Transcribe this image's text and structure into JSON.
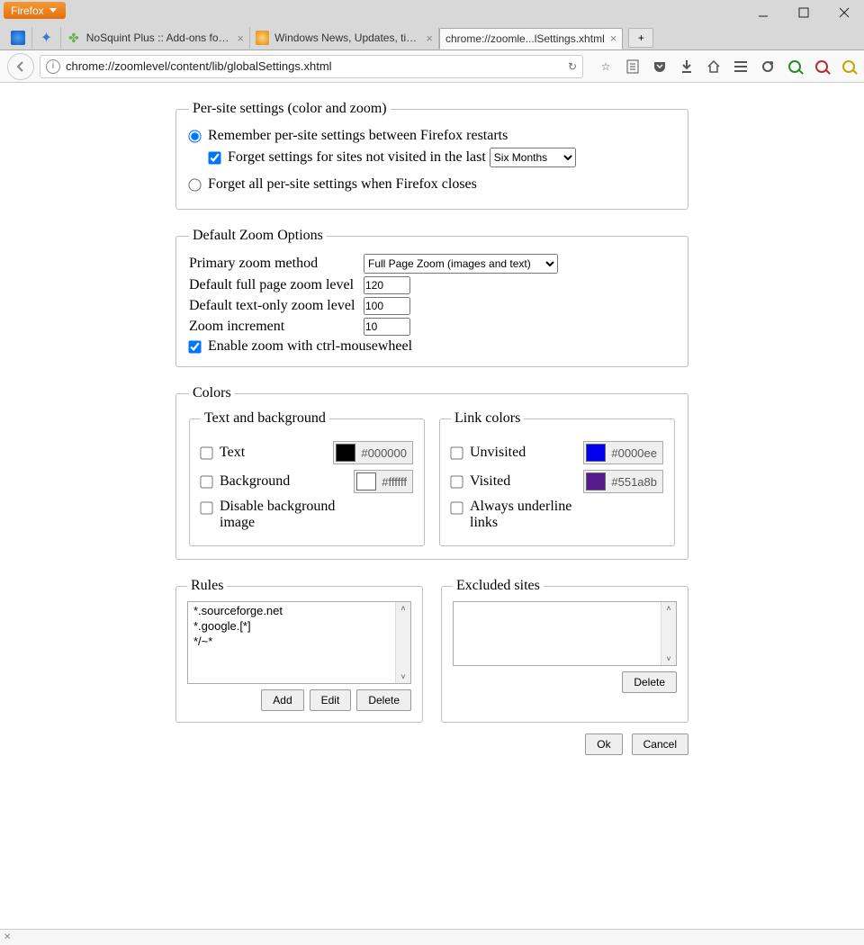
{
  "window": {
    "app_button": "Firefox"
  },
  "tabs": [
    {
      "label": "NoSquint Plus :: Add-ons for ..."
    },
    {
      "label": "Windows News, Updates, tips ..."
    },
    {
      "label": "chrome://zoomle...lSettings.xhtml"
    }
  ],
  "urlbar": {
    "value": "chrome://zoomlevel/content/lib/globalSettings.xhtml"
  },
  "persite": {
    "legend": "Per-site settings (color and zoom)",
    "remember_label": "Remember per-site settings between Firefox restarts",
    "forget_old_label": "Forget settings for sites not visited in the last",
    "forget_period": "Six Months",
    "forget_all_label": "Forget all per-site settings when Firefox closes"
  },
  "zoom": {
    "legend": "Default Zoom Options",
    "primary_label": "Primary zoom method",
    "primary_value": "Full Page Zoom (images and text)",
    "full_label": "Default full page zoom level",
    "full_value": "120",
    "text_label": "Default text-only zoom level",
    "text_value": "100",
    "increment_label": "Zoom increment",
    "increment_value": "10",
    "ctrlwheel_label": "Enable zoom with ctrl-mousewheel"
  },
  "colors": {
    "legend": "Colors",
    "tb_legend": "Text and background",
    "text_label": "Text",
    "text_hex": "#000000",
    "bg_label": "Background",
    "bg_hex": "#ffffff",
    "disable_bg_label": "Disable background image",
    "link_legend": "Link colors",
    "unvisited_label": "Unvisited",
    "unvisited_hex": "#0000ee",
    "visited_label": "Visited",
    "visited_hex": "#551a8b",
    "underline_label": "Always underline links"
  },
  "rules": {
    "legend": "Rules",
    "items": [
      "*.sourceforge.net",
      "*.google.[*]",
      "*/~*"
    ],
    "add": "Add",
    "edit": "Edit",
    "delete": "Delete"
  },
  "excluded": {
    "legend": "Excluded sites",
    "delete": "Delete"
  },
  "buttons": {
    "ok": "Ok",
    "cancel": "Cancel"
  }
}
